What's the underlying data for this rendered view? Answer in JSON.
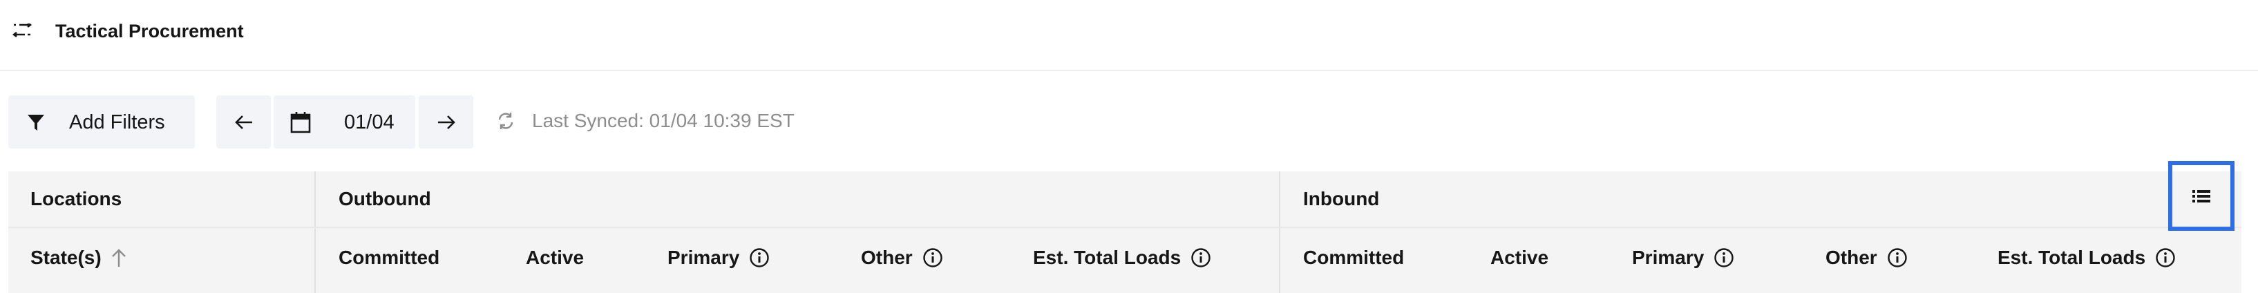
{
  "app": {
    "title": "Tactical Procurement",
    "icon": "swap-arrows-icon"
  },
  "toolbar": {
    "filters_label": "Add Filters",
    "date_value": "01/04",
    "last_synced": "Last Synced: 01/04 10:39 EST"
  },
  "table": {
    "groups": [
      "Locations",
      "Outbound",
      "Inbound"
    ],
    "columns": {
      "state": "State(s)",
      "out_committed": "Committed",
      "out_active": "Active",
      "out_primary": "Primary",
      "out_other": "Other",
      "out_est_total": "Est. Total Loads",
      "in_committed": "Committed",
      "in_active": "Active",
      "in_primary": "Primary",
      "in_other": "Other",
      "in_est_total": "Est. Total Loads"
    }
  },
  "colors": {
    "accent_highlight": "#2e6ee6",
    "button_bg": "#f2f4f8",
    "header_bg": "#f4f4f4",
    "muted_text": "#8d8d8d"
  }
}
